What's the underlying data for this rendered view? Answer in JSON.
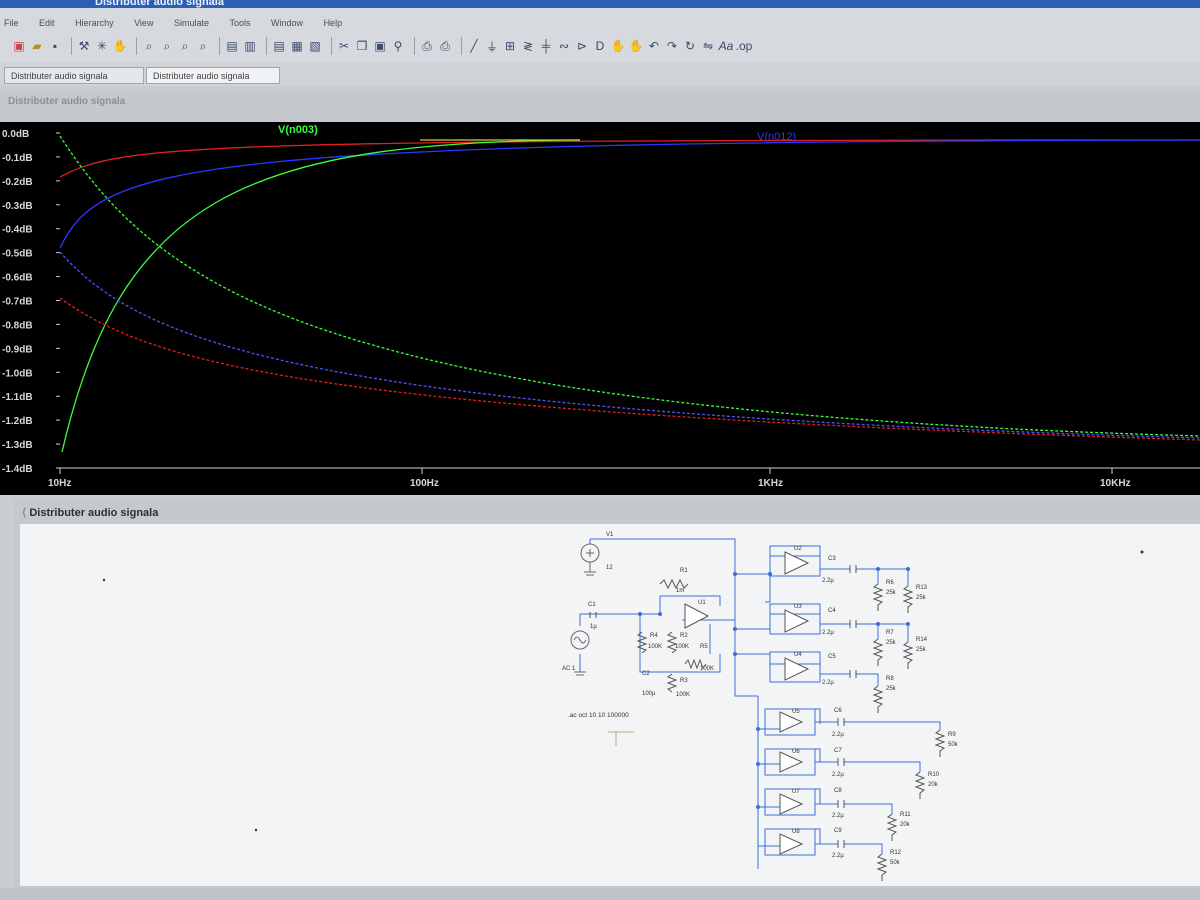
{
  "app": {
    "title": "Distributer audio signala",
    "menu": [
      "File",
      "Edit",
      "Hierarchy",
      "View",
      "Simulate",
      "Tools",
      "Window",
      "Help"
    ]
  },
  "tabs": [
    {
      "label": "Distributer audio signala"
    },
    {
      "label": "Distributer audio signala"
    }
  ],
  "plot": {
    "window_title": "Distributer audio signala",
    "traces": [
      {
        "label": "V(n003)",
        "color": "#39ff3a"
      },
      {
        "label": "V(n012)",
        "color": "#2a38ff"
      }
    ],
    "y_ticks": [
      "0.0dB",
      "-0.1dB",
      "-0.2dB",
      "-0.3dB",
      "-0.4dB",
      "-0.5dB",
      "-0.6dB",
      "-0.7dB",
      "-0.8dB",
      "-0.9dB",
      "-1.0dB",
      "-1.1dB",
      "-1.2dB",
      "-1.3dB",
      "-1.4dB"
    ],
    "x_ticks": [
      "10Hz",
      "100Hz",
      "1KHz",
      "10KHz"
    ]
  },
  "schematic": {
    "window_title": "Distributer audio signala",
    "directive": ".ac oct 10 10 100000",
    "source_v1": {
      "name": "V1",
      "value": "12"
    },
    "source_ac": {
      "value": "AC 1"
    },
    "labels": {
      "c1": "C1",
      "c1v": "1µ",
      "r1": "R1",
      "r1v": "1m",
      "r4": "R4",
      "r4v": "100K",
      "r2": "R2",
      "r2v": "100K",
      "r5": "R5",
      "r5v": "100K",
      "c2": "C2",
      "c2v": "100µ",
      "r3": "R3",
      "r3v": "100K",
      "u1": "U1",
      "u2": "U2",
      "u3": "U3",
      "u4": "U4",
      "u5": "U5",
      "u6": "U6",
      "u7": "U7",
      "u8": "U8",
      "c3": "C3",
      "c4": "C4",
      "c5": "C5",
      "c6": "C6",
      "c7": "C7",
      "c8": "C8",
      "c9": "C9",
      "cv": "2.2µ",
      "r6": "R6",
      "r7": "R7",
      "r8": "R8",
      "rv25": "25k",
      "r13": "R13",
      "r14": "R14",
      "r9": "R9",
      "r10": "R10",
      "r11": "R11",
      "r12": "R12",
      "rv50": "50k",
      "rv20": "20k"
    }
  }
}
